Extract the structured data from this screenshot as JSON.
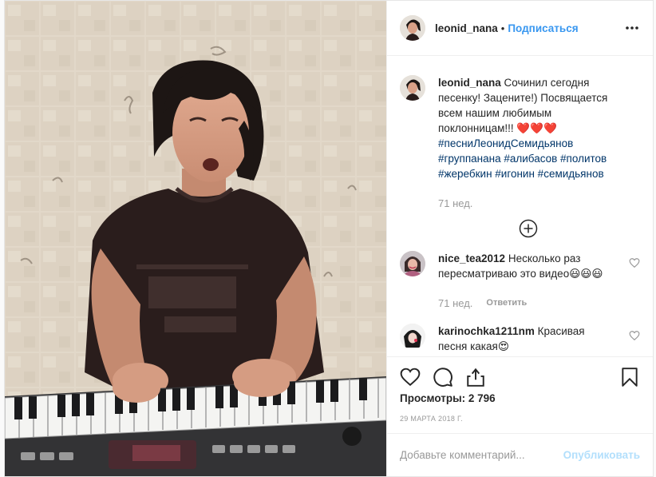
{
  "header": {
    "username": "leonid_nana",
    "separator": "•",
    "follow_label": "Подписаться"
  },
  "caption": {
    "username": "leonid_nana",
    "text": "Сочинил сегодня песенку! Заценитe!) Посвящается всем нашим любимым поклонницам!!! ❤️❤️❤️",
    "hashtags_line1": "#песниЛеонидСемидьянов",
    "hashtags_line2": "#группанана #алибасов #политов",
    "hashtags_line3": "#жеребкин #игонин #семидьянов",
    "time": "71 нед."
  },
  "comments": [
    {
      "username": "nice_tea2012",
      "text": "Несколько раз пересматриваю это видео😃😃😃",
      "time": "71 нед.",
      "reply": "Ответить"
    },
    {
      "username": "karinochka1211nm",
      "text": "Красивая песня какая😍",
      "time": "",
      "reply": ""
    }
  ],
  "stats": {
    "views_label": "Просмотры: 2 796",
    "date": "29 МАРТА 2018 Г."
  },
  "add_comment": {
    "placeholder": "Добавьте комментарий...",
    "post_label": "Опубликовать"
  },
  "icons": [
    "more-options-icon",
    "load-more-icon",
    "like-icon",
    "comment-icon",
    "share-icon",
    "save-icon",
    "comment-like-icon"
  ],
  "colors": {
    "accent": "#3897f0",
    "hashtag": "#003569",
    "muted": "#999999",
    "post_disabled": "#b2dffc"
  }
}
